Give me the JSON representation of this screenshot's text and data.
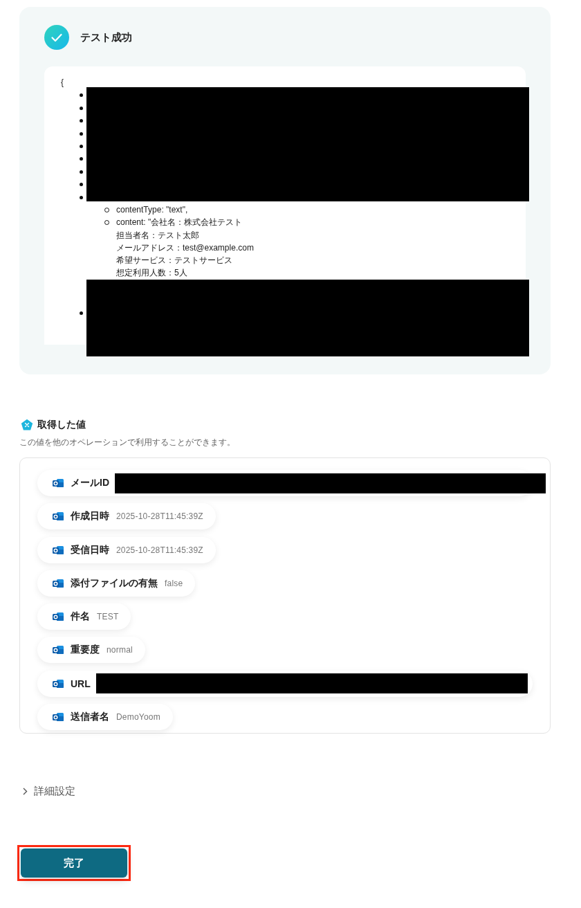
{
  "test_result": {
    "title": "テスト成功",
    "code_lines": [
      {
        "kind": "text",
        "text": "{"
      },
      {
        "kind": "redacted_bullets",
        "items": [
          {
            "kind": "bullet"
          },
          {
            "kind": "bullet"
          },
          {
            "kind": "bullet"
          },
          {
            "kind": "bullet"
          },
          {
            "kind": "bullet"
          },
          {
            "kind": "bullet"
          },
          {
            "kind": "bullet"
          },
          {
            "kind": "bullet"
          },
          {
            "kind": "bullet"
          }
        ]
      },
      {
        "kind": "sub_list",
        "items": [
          {
            "text": "contentType: \"text\","
          },
          {
            "text": "content: \"会社名：株式会社テスト",
            "continuation": [
              "担当者名：テスト太郎",
              "メールアドレス：test@example.com",
              "希望サービス：テストサービス",
              "想定利用人数：5人"
            ]
          }
        ]
      },
      {
        "kind": "redacted_block",
        "items": [
          {
            "kind": "bullet"
          }
        ]
      }
    ]
  },
  "obtained_values": {
    "title": "取得した値",
    "description": "この値を他のオペレーションで利用することができます。",
    "items": [
      {
        "label": "メールID",
        "kind": "redacted"
      },
      {
        "label": "作成日時",
        "kind": "text",
        "value": "2025-10-28T11:45:39Z"
      },
      {
        "label": "受信日時",
        "kind": "text",
        "value": "2025-10-28T11:45:39Z"
      },
      {
        "label": "添付ファイルの有無",
        "kind": "text",
        "value": "false"
      },
      {
        "label": "件名",
        "kind": "text",
        "value": "TEST"
      },
      {
        "label": "重要度",
        "kind": "text",
        "value": "normal"
      },
      {
        "label": "URL",
        "kind": "redacted"
      },
      {
        "label": "送信者名",
        "kind": "text",
        "value": "DemoYoom"
      }
    ]
  },
  "advanced_settings": {
    "label": "詳細設定",
    "expanded": false
  },
  "done_button": {
    "label": "完了",
    "highlighted": true
  }
}
